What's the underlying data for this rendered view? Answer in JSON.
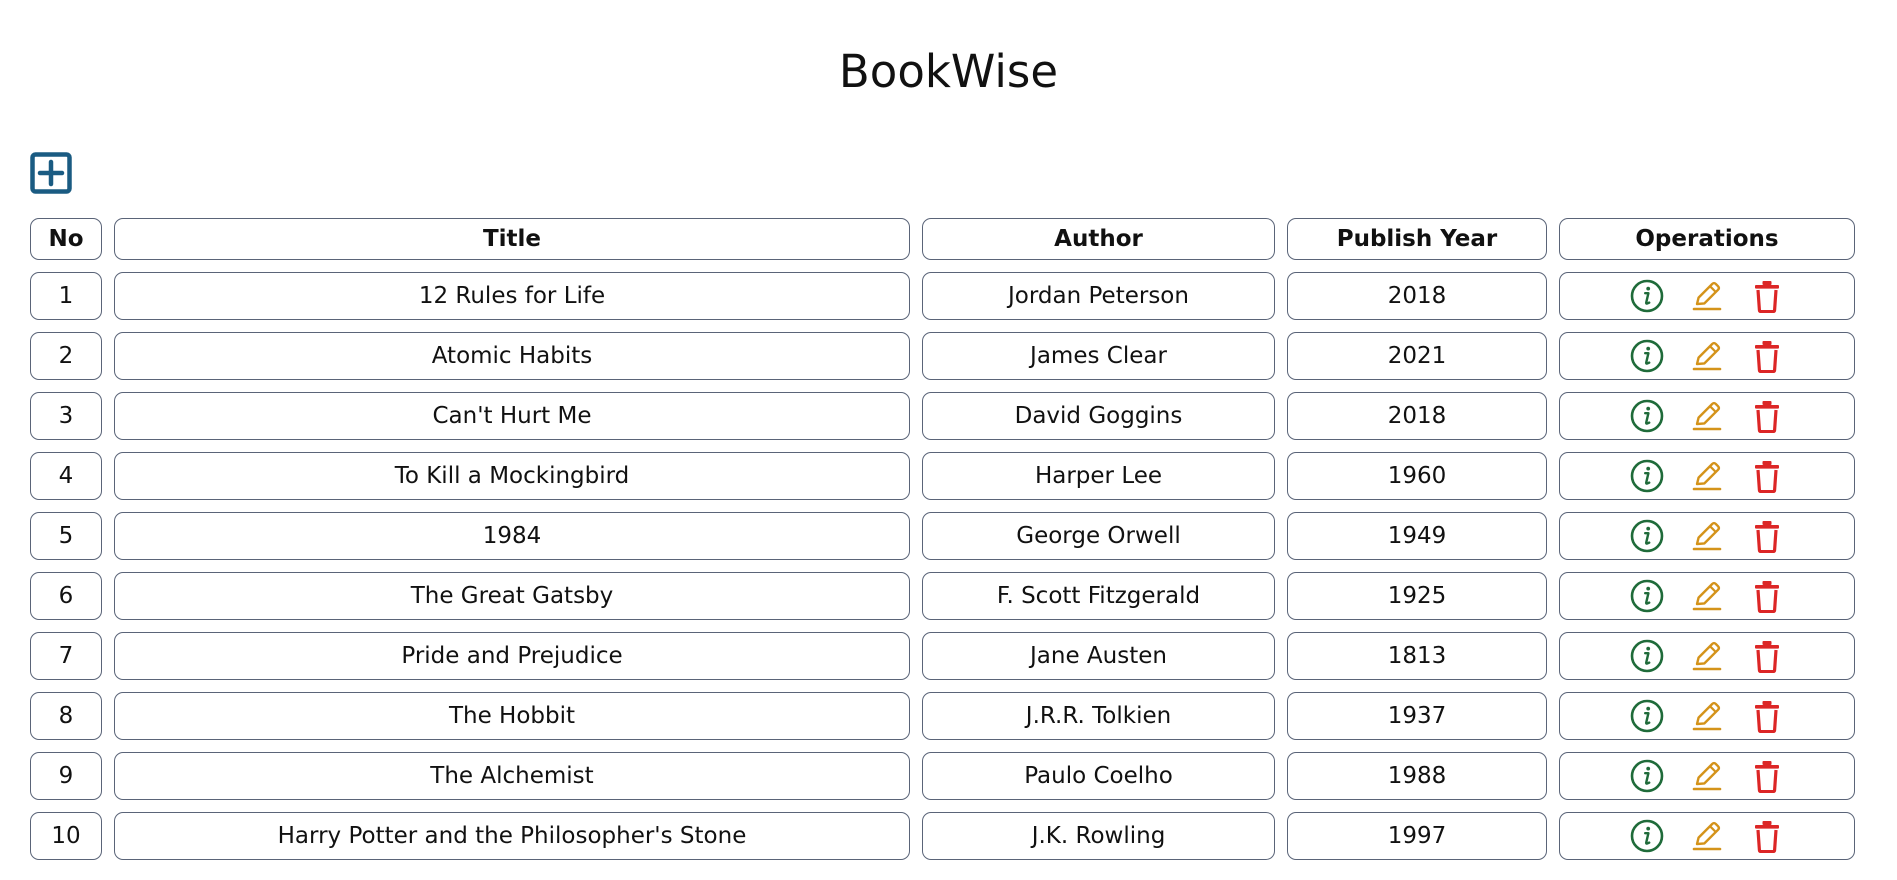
{
  "app": {
    "title": "BookWise"
  },
  "colors": {
    "add_button": "#1a5b82",
    "info_icon": "#1f6b3a",
    "edit_icon": "#d4931a",
    "delete_icon": "#dc2626",
    "cell_border": "#5a6478"
  },
  "icons": {
    "add": "plus-square-icon",
    "info": "info-circle-icon",
    "edit": "pencil-icon",
    "delete": "trash-icon"
  },
  "table": {
    "headers": {
      "no": "No",
      "title": "Title",
      "author": "Author",
      "year": "Publish Year",
      "operations": "Operations"
    },
    "rows": [
      {
        "no": "1",
        "title": "12 Rules for Life",
        "author": "Jordan Peterson",
        "year": "2018"
      },
      {
        "no": "2",
        "title": "Atomic Habits",
        "author": "James Clear",
        "year": "2021"
      },
      {
        "no": "3",
        "title": "Can't Hurt Me",
        "author": "David Goggins",
        "year": "2018"
      },
      {
        "no": "4",
        "title": "To Kill a Mockingbird",
        "author": "Harper Lee",
        "year": "1960"
      },
      {
        "no": "5",
        "title": "1984",
        "author": "George Orwell",
        "year": "1949"
      },
      {
        "no": "6",
        "title": "The Great Gatsby",
        "author": "F. Scott Fitzgerald",
        "year": "1925"
      },
      {
        "no": "7",
        "title": "Pride and Prejudice",
        "author": "Jane Austen",
        "year": "1813"
      },
      {
        "no": "8",
        "title": "The Hobbit",
        "author": "J.R.R. Tolkien",
        "year": "1937"
      },
      {
        "no": "9",
        "title": "The Alchemist",
        "author": "Paulo Coelho",
        "year": "1988"
      },
      {
        "no": "10",
        "title": "Harry Potter and the Philosopher's Stone",
        "author": "J.K. Rowling",
        "year": "1997"
      }
    ]
  }
}
